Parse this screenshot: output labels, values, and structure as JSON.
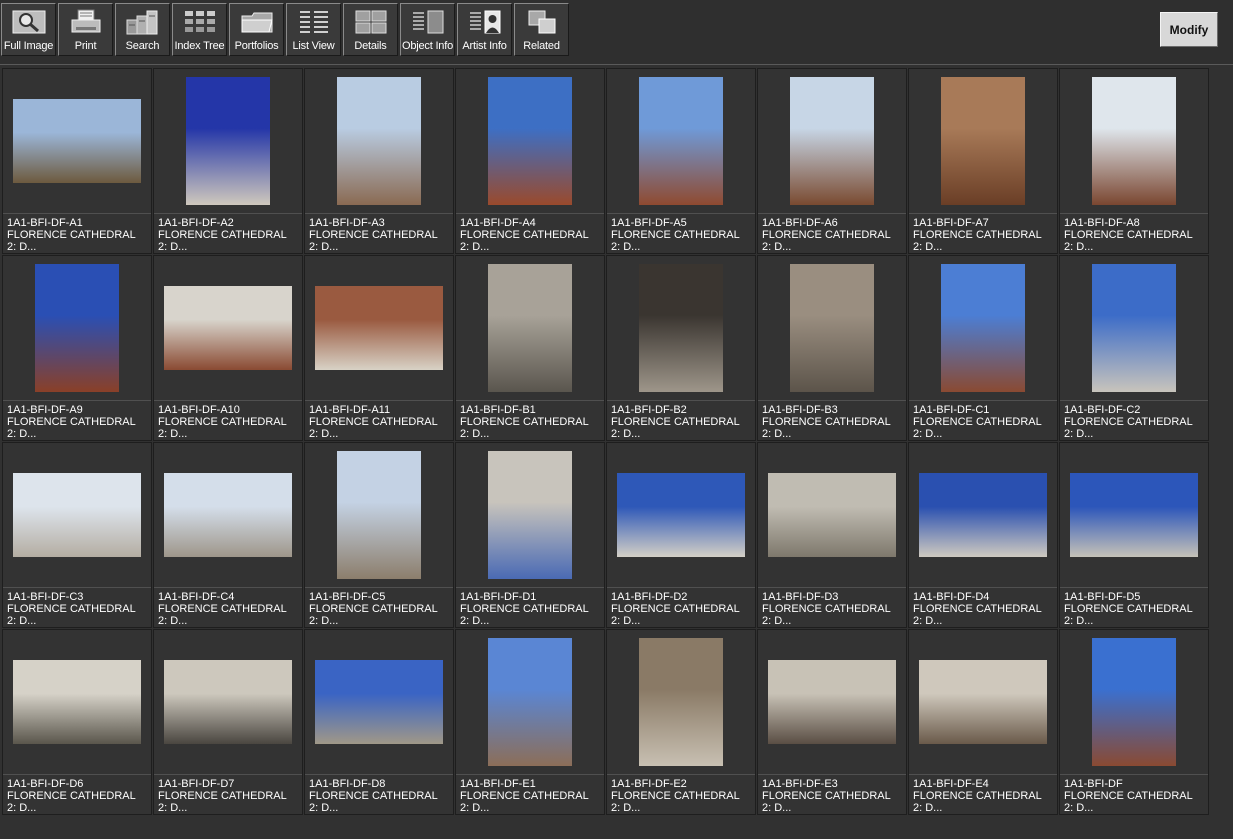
{
  "toolbar": {
    "buttons": [
      {
        "label": "Full Image",
        "icon": "magnifier-icon"
      },
      {
        "label": "Print",
        "icon": "printer-icon"
      },
      {
        "label": "Search",
        "icon": "search-stack-icon"
      },
      {
        "label": "Index Tree",
        "icon": "index-tree-icon"
      },
      {
        "label": "Portfolios",
        "icon": "folder-icon"
      },
      {
        "label": "List View",
        "icon": "list-view-icon"
      },
      {
        "label": "Details",
        "icon": "details-grid-icon"
      },
      {
        "label": "Object Info",
        "icon": "object-info-icon"
      },
      {
        "label": "Artist  Info",
        "icon": "artist-info-icon"
      },
      {
        "label": "Related",
        "icon": "related-icon"
      }
    ],
    "modify_label": "Modify"
  },
  "thumbnails": [
    {
      "id": "1A1-BFI-DF-A1",
      "title": "FLORENCE CATHEDRAL",
      "sub": "2: D...",
      "orient": "landscape",
      "colors": [
        "#9bb6d8",
        "#6d5a3e"
      ]
    },
    {
      "id": "1A1-BFI-DF-A2",
      "title": "FLORENCE CATHEDRAL",
      "sub": "2: D...",
      "orient": "portrait",
      "colors": [
        "#2436a8",
        "#cfc8bd"
      ]
    },
    {
      "id": "1A1-BFI-DF-A3",
      "title": "FLORENCE CATHEDRAL",
      "sub": "2: D...",
      "orient": "portrait",
      "colors": [
        "#b9cce2",
        "#8a6a52"
      ]
    },
    {
      "id": "1A1-BFI-DF-A4",
      "title": "FLORENCE CATHEDRAL",
      "sub": "2: D...",
      "orient": "portrait",
      "colors": [
        "#3d6fc4",
        "#9a4a2c"
      ]
    },
    {
      "id": "1A1-BFI-DF-A5",
      "title": "FLORENCE CATHEDRAL",
      "sub": "2: D...",
      "orient": "portrait",
      "colors": [
        "#6f9ad8",
        "#8f4a30"
      ]
    },
    {
      "id": "1A1-BFI-DF-A6",
      "title": "FLORENCE CATHEDRAL",
      "sub": "2: D...",
      "orient": "portrait",
      "colors": [
        "#c7d6e6",
        "#7a4a30"
      ]
    },
    {
      "id": "1A1-BFI-DF-A7",
      "title": "FLORENCE CATHEDRAL",
      "sub": "2: D...",
      "orient": "portrait",
      "colors": [
        "#a87a58",
        "#6a3e26"
      ]
    },
    {
      "id": "1A1-BFI-DF-A8",
      "title": "FLORENCE CATHEDRAL",
      "sub": "2: D...",
      "orient": "portrait",
      "colors": [
        "#dfe6ec",
        "#7a4630"
      ]
    },
    {
      "id": "1A1-BFI-DF-A9",
      "title": "FLORENCE CATHEDRAL",
      "sub": "2: D...",
      "orient": "portrait",
      "colors": [
        "#2a4fb4",
        "#8a4028"
      ]
    },
    {
      "id": "1A1-BFI-DF-A10",
      "title": "FLORENCE CATHEDRAL",
      "sub": "2: D...",
      "orient": "landscape",
      "colors": [
        "#d8d4cc",
        "#8a4a32"
      ]
    },
    {
      "id": "1A1-BFI-DF-A11",
      "title": "FLORENCE CATHEDRAL",
      "sub": "2: D...",
      "orient": "landscape",
      "colors": [
        "#9a5a40",
        "#d8d2c6"
      ]
    },
    {
      "id": "1A1-BFI-DF-B1",
      "title": "FLORENCE CATHEDRAL",
      "sub": "2: D...",
      "orient": "portrait",
      "colors": [
        "#a8a298",
        "#5a564e"
      ]
    },
    {
      "id": "1A1-BFI-DF-B2",
      "title": "FLORENCE CATHEDRAL",
      "sub": "2: D...",
      "orient": "portrait",
      "colors": [
        "#3a3530",
        "#9e968a"
      ]
    },
    {
      "id": "1A1-BFI-DF-B3",
      "title": "FLORENCE CATHEDRAL",
      "sub": "2: D...",
      "orient": "portrait",
      "colors": [
        "#9a8e80",
        "#5c544a"
      ]
    },
    {
      "id": "1A1-BFI-DF-C1",
      "title": "FLORENCE CATHEDRAL",
      "sub": "2: D...",
      "orient": "portrait",
      "colors": [
        "#4c7ed4",
        "#8a4a32"
      ]
    },
    {
      "id": "1A1-BFI-DF-C2",
      "title": "FLORENCE CATHEDRAL",
      "sub": "2: D...",
      "orient": "portrait",
      "colors": [
        "#3c6cc8",
        "#c8c4bc"
      ]
    },
    {
      "id": "1A1-BFI-DF-C3",
      "title": "FLORENCE CATHEDRAL",
      "sub": "2: D...",
      "orient": "landscape",
      "colors": [
        "#dde4ec",
        "#b4ada2"
      ]
    },
    {
      "id": "1A1-BFI-DF-C4",
      "title": "FLORENCE CATHEDRAL",
      "sub": "2: D...",
      "orient": "landscape",
      "colors": [
        "#d4deea",
        "#9e968a"
      ]
    },
    {
      "id": "1A1-BFI-DF-C5",
      "title": "FLORENCE CATHEDRAL",
      "sub": "2: D...",
      "orient": "portrait",
      "colors": [
        "#c4d2e4",
        "#8c7e6c"
      ]
    },
    {
      "id": "1A1-BFI-DF-D1",
      "title": "FLORENCE CATHEDRAL",
      "sub": "2: D...",
      "orient": "portrait",
      "colors": [
        "#c8c4bc",
        "#4a6ab4"
      ]
    },
    {
      "id": "1A1-BFI-DF-D2",
      "title": "FLORENCE CATHEDRAL",
      "sub": "2: D...",
      "orient": "landscape",
      "colors": [
        "#2e58b8",
        "#d4d0c6"
      ]
    },
    {
      "id": "1A1-BFI-DF-D3",
      "title": "FLORENCE CATHEDRAL",
      "sub": "2: D...",
      "orient": "landscape",
      "colors": [
        "#c0bcb2",
        "#7e786c"
      ]
    },
    {
      "id": "1A1-BFI-DF-D4",
      "title": "FLORENCE CATHEDRAL",
      "sub": "2: D...",
      "orient": "landscape",
      "colors": [
        "#2a50b0",
        "#cfcac0"
      ]
    },
    {
      "id": "1A1-BFI-DF-D5",
      "title": "FLORENCE CATHEDRAL",
      "sub": "2: D...",
      "orient": "landscape",
      "colors": [
        "#2c56ba",
        "#c6c2b8"
      ]
    },
    {
      "id": "1A1-BFI-DF-D6",
      "title": "FLORENCE CATHEDRAL",
      "sub": "2: D...",
      "orient": "landscape",
      "colors": [
        "#d6d2c8",
        "#5a564c"
      ]
    },
    {
      "id": "1A1-BFI-DF-D7",
      "title": "FLORENCE CATHEDRAL",
      "sub": "2: D...",
      "orient": "landscape",
      "colors": [
        "#cdc8bd",
        "#4a4640"
      ]
    },
    {
      "id": "1A1-BFI-DF-D8",
      "title": "FLORENCE CATHEDRAL",
      "sub": "2: D...",
      "orient": "landscape",
      "colors": [
        "#3a64c4",
        "#a09888"
      ]
    },
    {
      "id": "1A1-BFI-DF-E1",
      "title": "FLORENCE CATHEDRAL",
      "sub": "2: D...",
      "orient": "portrait",
      "colors": [
        "#5a86d4",
        "#8c6e58"
      ]
    },
    {
      "id": "1A1-BFI-DF-E2",
      "title": "FLORENCE CATHEDRAL",
      "sub": "2: D...",
      "orient": "portrait",
      "colors": [
        "#8a7a66",
        "#c8c0b2"
      ]
    },
    {
      "id": "1A1-BFI-DF-E3",
      "title": "FLORENCE CATHEDRAL",
      "sub": "2: D...",
      "orient": "landscape",
      "colors": [
        "#c8c2b6",
        "#5a4e44"
      ]
    },
    {
      "id": "1A1-BFI-DF-E4",
      "title": "FLORENCE CATHEDRAL",
      "sub": "2: D...",
      "orient": "landscape",
      "colors": [
        "#cfc8bc",
        "#6a5a4a"
      ]
    },
    {
      "id": "1A1-BFI-DF",
      "title": "FLORENCE CATHEDRAL",
      "sub": "2: D...",
      "orient": "portrait",
      "colors": [
        "#3a70d0",
        "#8a4a32"
      ]
    }
  ]
}
